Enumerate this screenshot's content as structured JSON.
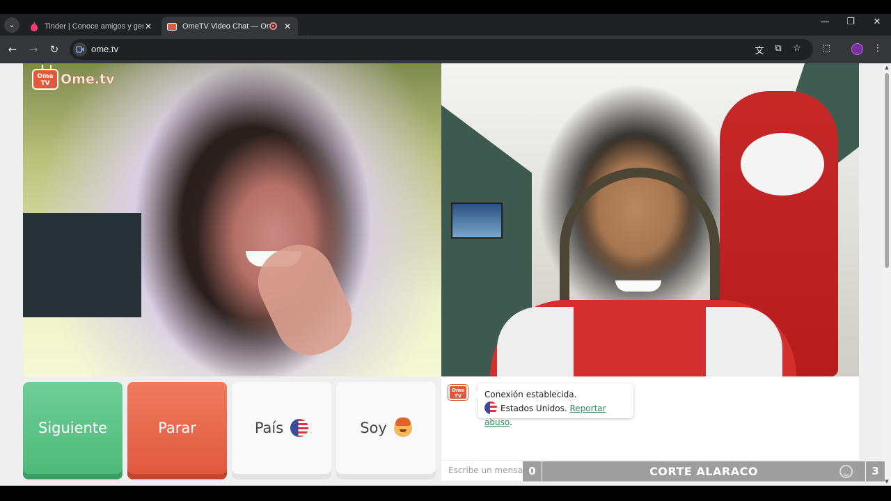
{
  "browser": {
    "tabs": [
      {
        "title": "Tinder | Conoce amigos y gente",
        "active": false,
        "icon": "tinder-flame-icon"
      },
      {
        "title": "OmeTV Video Chat — Ome",
        "active": true,
        "icon": "ometv-icon",
        "recording": true
      }
    ],
    "new_tab": "+",
    "window_controls": {
      "minimize": "—",
      "restore": "❐",
      "close": "✕"
    },
    "url": "ome.tv"
  },
  "app": {
    "logo": {
      "tv_text": "Ome\nTV",
      "word": "Ome.tv"
    },
    "buttons": {
      "next": "Siguiente",
      "stop": "Parar",
      "country": "País",
      "gender": "Soy"
    },
    "chat": {
      "message_line1": "Conexión establecida.",
      "country": "Estados Unidos.",
      "report_link": "Reportar abuso",
      "report_suffix": ".",
      "input_placeholder": "Escribe un mensaje"
    },
    "colors": {
      "next": "#4cb878",
      "stop": "#e0573d",
      "link": "#2e8b57"
    }
  },
  "overlay": {
    "left_score": "0",
    "title": "CORTE ALARACO",
    "right_score": "3"
  }
}
